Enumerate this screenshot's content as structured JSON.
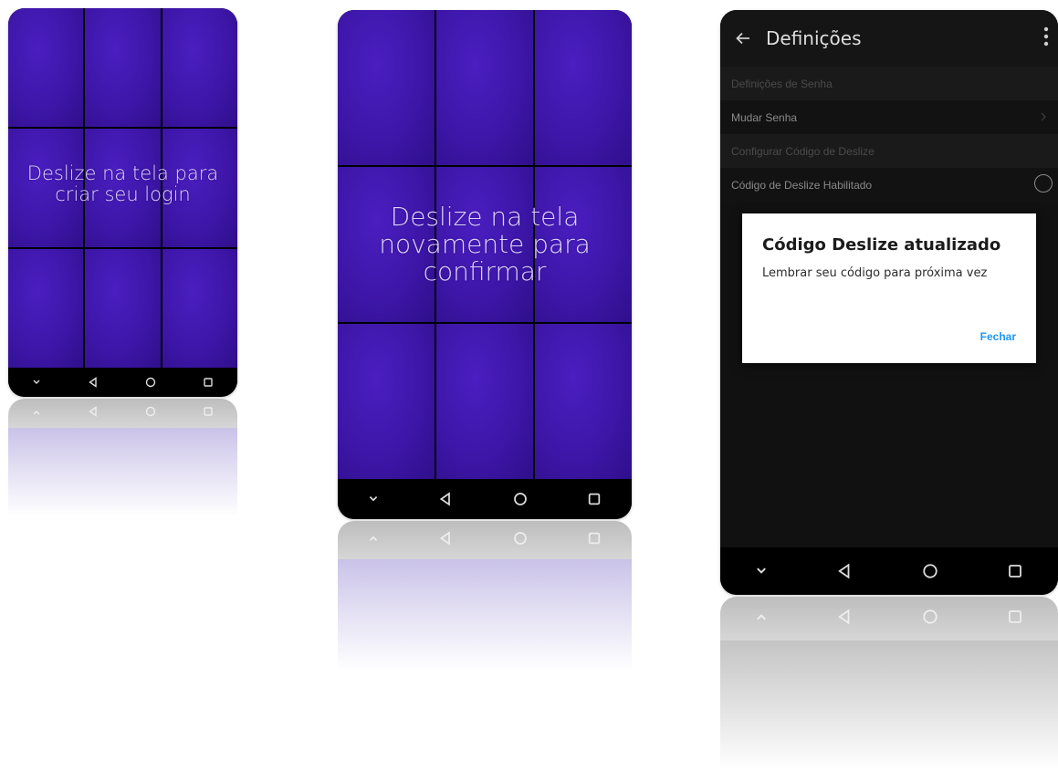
{
  "phone1": {
    "message": "Deslize na tela para criar seu login"
  },
  "phone2": {
    "message": "Deslize na tela novamente para confirmar"
  },
  "phone3": {
    "appbar": {
      "title": "Definições"
    },
    "sections": [
      {
        "header": "Definições de Senha",
        "items": [
          "Mudar Senha"
        ]
      },
      {
        "header": "Configurar Código de Deslize",
        "items": [
          "Código de Deslize Habilitado"
        ]
      }
    ],
    "dialog": {
      "title": "Código Deslize atualizado",
      "message": "Lembrar seu código para próxima vez",
      "action": "Fechar"
    }
  },
  "navbar": {
    "icons": [
      "chevron-down-icon",
      "back-triangle-icon",
      "home-circle-icon",
      "recents-square-icon"
    ]
  },
  "colors": {
    "grid_purple": "#3d16a8",
    "dialog_action": "#2196f3",
    "settings_bg": "#111111"
  }
}
